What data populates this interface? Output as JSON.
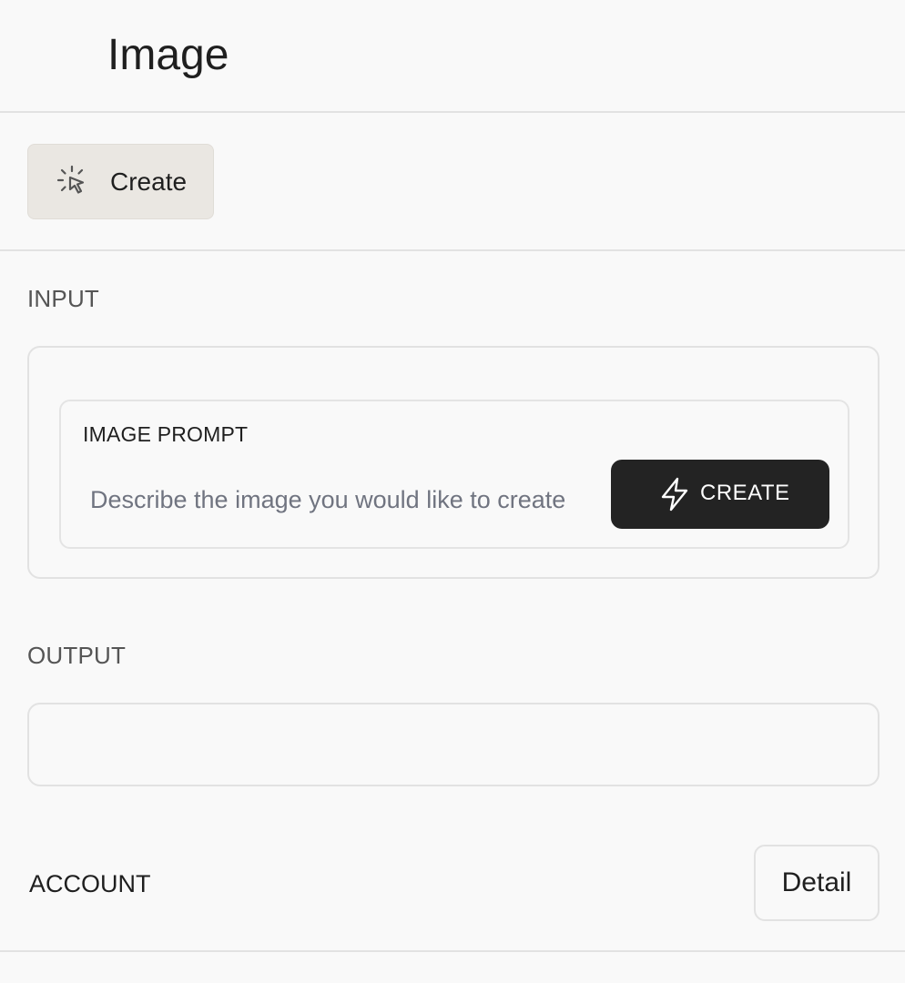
{
  "header": {
    "title": "Image"
  },
  "toolbar": {
    "create_label": "Create",
    "create_icon": "cursor-click-icon"
  },
  "input_section": {
    "label": "INPUT",
    "prompt_label": "IMAGE PROMPT",
    "prompt_placeholder": "Describe the image you would like to create",
    "prompt_value": "",
    "create_button_label": "CREATE",
    "create_button_icon": "lightning-bolt-icon"
  },
  "output_section": {
    "label": "OUTPUT"
  },
  "account": {
    "label": "ACCOUNT",
    "detail_button_label": "Detail"
  },
  "colors": {
    "background": "#f9f9f9",
    "toolbar_button_bg": "#eae7e2",
    "primary_button_bg": "#232323",
    "border": "#e2e2e2",
    "placeholder": "#707480"
  }
}
